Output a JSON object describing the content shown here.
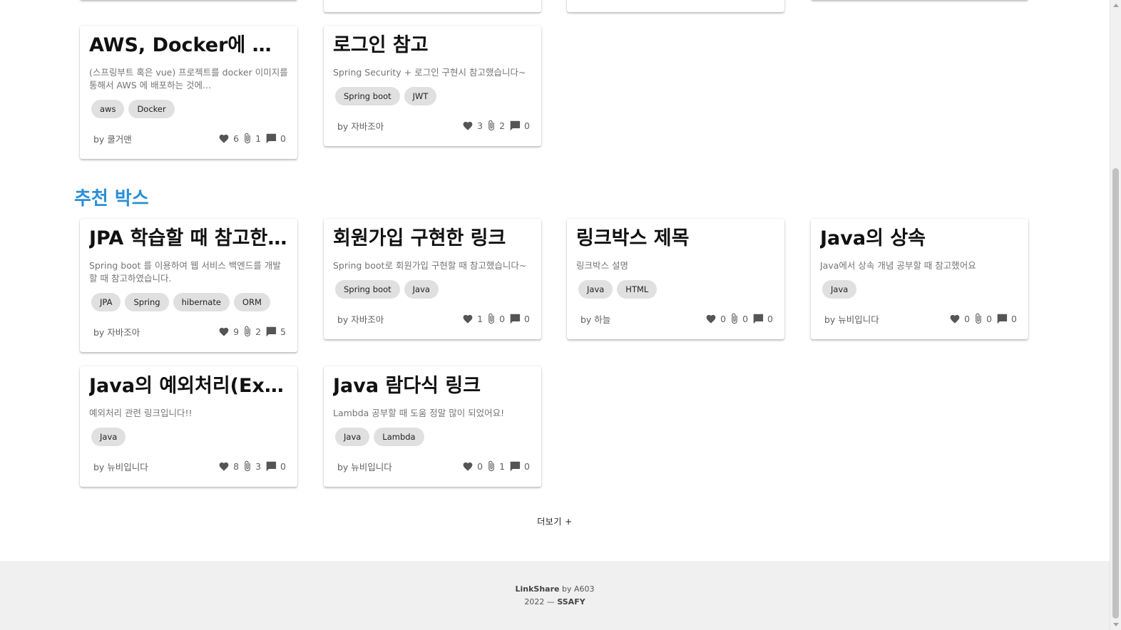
{
  "top_cards": [
    {
      "title": "AWS, Docker에 대한 ...",
      "description": "(스프링부트 혹은 vue) 프로젝트를 docker 이미지를 통해서 AWS 에 배포하는 것에...",
      "tags": [
        "aws",
        "Docker"
      ],
      "author": "by 쿨거맨",
      "likes": "6",
      "attachments": "1",
      "comments": "0"
    },
    {
      "title": "로그인 참고",
      "description": "Spring Security + 로그인 구현시 참고했습니다~",
      "tags": [
        "Spring boot",
        "JWT"
      ],
      "author": "by 자바조아",
      "likes": "3",
      "attachments": "2",
      "comments": "0"
    }
  ],
  "section": {
    "title": "추천 박스"
  },
  "recommend_cards": [
    {
      "title": "JPA 학습할 때 참고한 ...",
      "description": "Spring boot 를 이용하여 웹 서비스 백엔드를 개발할 때 참고하였습니다.",
      "tags": [
        "JPA",
        "Spring",
        "hibernate",
        "ORM"
      ],
      "author": "by 자바조아",
      "likes": "9",
      "attachments": "2",
      "comments": "5"
    },
    {
      "title": "회원가입 구현한 링크",
      "description": "Spring boot로 회원가입 구현할 때 참고했습니다~",
      "tags": [
        "Spring boot",
        "Java"
      ],
      "author": "by 자바조아",
      "likes": "1",
      "attachments": "0",
      "comments": "0"
    },
    {
      "title": "링크박스 제목",
      "description": "링크박스 설명",
      "tags": [
        "Java",
        "HTML"
      ],
      "author": "by 하늘",
      "likes": "0",
      "attachments": "0",
      "comments": "0"
    },
    {
      "title": "Java의 상속",
      "description": "Java에서 상속 개념 공부할 때 참고했어요",
      "tags": [
        "Java"
      ],
      "author": "by 뉴비입니다",
      "likes": "0",
      "attachments": "0",
      "comments": "0"
    },
    {
      "title": "Java의 예외처리(Exce...",
      "description": "예외처리 관련 링크입니다!!",
      "tags": [
        "Java"
      ],
      "author": "by 뉴비입니다",
      "likes": "8",
      "attachments": "3",
      "comments": "0"
    },
    {
      "title": "Java 람다식 링크",
      "description": "Lambda 공부할 때 도움 정말 많이 되었어요!",
      "tags": [
        "Java",
        "Lambda"
      ],
      "author": "by 뉴비입니다",
      "likes": "0",
      "attachments": "1",
      "comments": "0"
    }
  ],
  "more_button": {
    "label": "더보기 +"
  },
  "footer": {
    "brand": "LinkShare",
    "by_text": " by A603",
    "year_text": "2022 — ",
    "org": "SSAFY"
  },
  "icons": {
    "likes": "heart-icon",
    "attachments": "paperclip-icon",
    "comments": "comment-icon"
  },
  "colors": {
    "section_title": "#2b8fd6",
    "tag_background": "#e0e0e0",
    "footer_background": "#f0f0f0"
  }
}
